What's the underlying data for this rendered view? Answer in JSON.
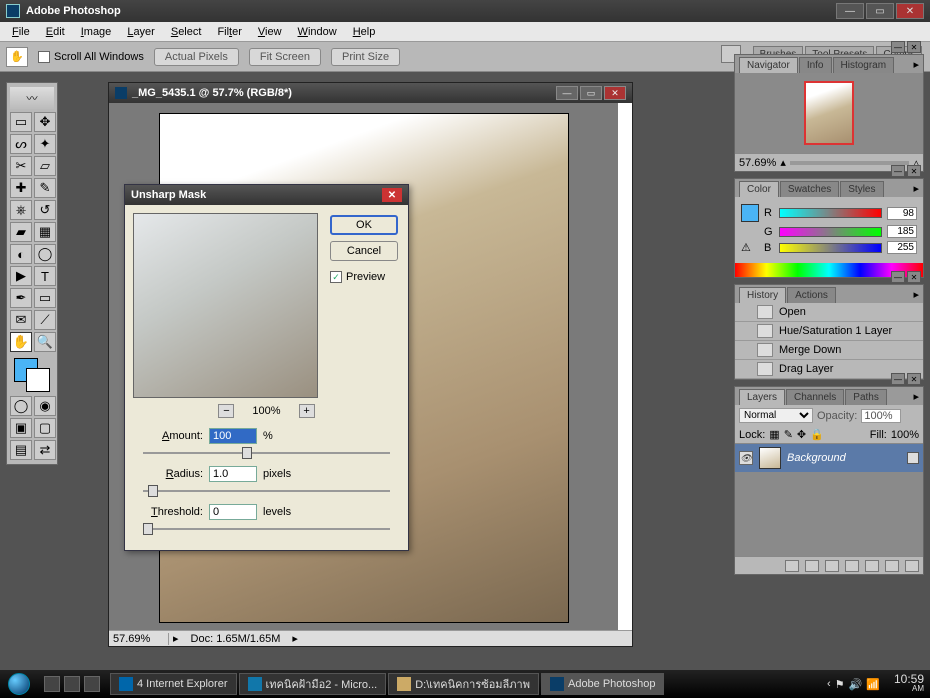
{
  "app": {
    "title": "Adobe Photoshop"
  },
  "menu": [
    "File",
    "Edit",
    "Image",
    "Layer",
    "Select",
    "Filter",
    "View",
    "Window",
    "Help"
  ],
  "options": {
    "scroll_all": "Scroll All Windows",
    "buttons": [
      "Actual Pixels",
      "Fit Screen",
      "Print Size"
    ]
  },
  "tr_tabs": [
    "Brushes",
    "Tool Presets",
    "Comps"
  ],
  "document": {
    "title": "_MG_5435.1 @ 57.7% (RGB/8*)",
    "zoom": "57.69%",
    "doc_info": "Doc: 1.65M/1.65M"
  },
  "dialog": {
    "title": "Unsharp Mask",
    "ok": "OK",
    "cancel": "Cancel",
    "preview_label": "Preview",
    "zoom": "100%",
    "amount_label": "Amount:",
    "amount_value": "100",
    "amount_unit": "%",
    "radius_label": "Radius:",
    "radius_value": "1.0",
    "radius_unit": "pixels",
    "threshold_label": "Threshold:",
    "threshold_value": "0",
    "threshold_unit": "levels"
  },
  "navigator": {
    "tabs": [
      "Navigator",
      "Info",
      "Histogram"
    ],
    "zoom": "57.69%"
  },
  "color": {
    "tabs": [
      "Color",
      "Swatches",
      "Styles"
    ],
    "r": "98",
    "g": "185",
    "b": "255"
  },
  "history": {
    "tabs": [
      "History",
      "Actions"
    ],
    "items": [
      "Open",
      "Hue/Saturation 1 Layer",
      "Merge Down",
      "Drag Layer"
    ]
  },
  "layers": {
    "tabs": [
      "Layers",
      "Channels",
      "Paths"
    ],
    "blend": "Normal",
    "opacity_label": "Opacity:",
    "opacity": "100%",
    "lock_label": "Lock:",
    "fill_label": "Fill:",
    "fill": "100%",
    "layer_name": "Background"
  },
  "taskbar": {
    "tasks": [
      {
        "label": "4 Internet Explorer"
      },
      {
        "label": "เทคนิคฝ้ามือ2 - Micro..."
      },
      {
        "label": "D:\\เทคนิคการซ้อมลีภาพ"
      },
      {
        "label": "Adobe Photoshop"
      }
    ],
    "time": "10:59",
    "ampm": "AM"
  }
}
